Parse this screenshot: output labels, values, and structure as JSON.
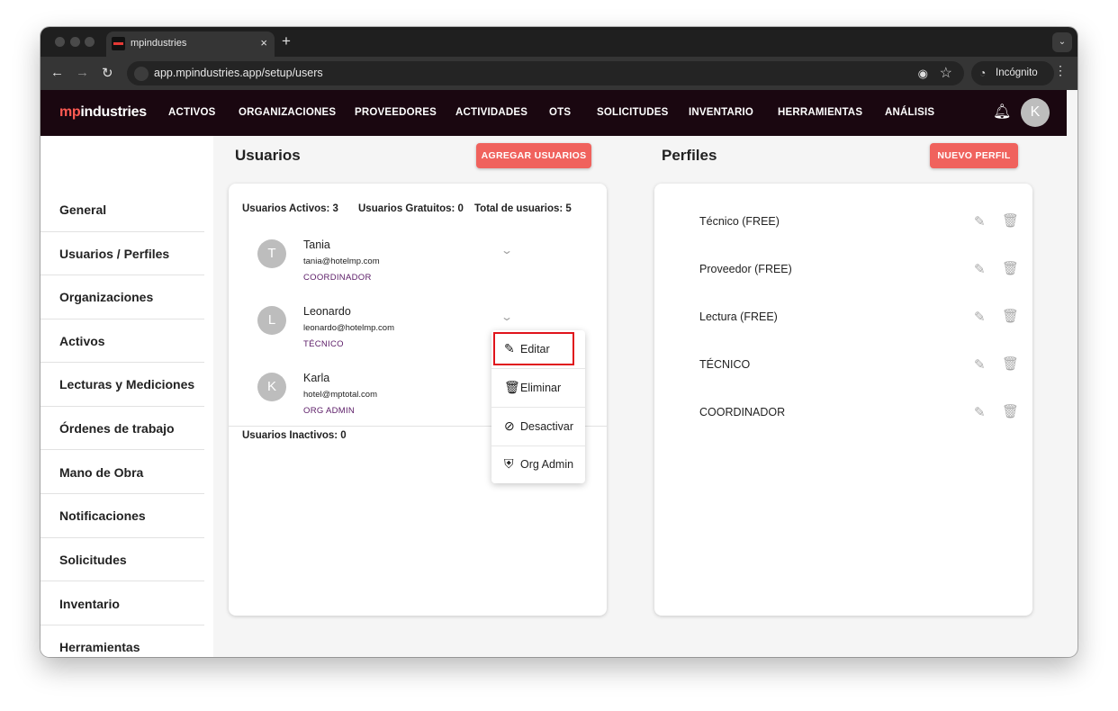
{
  "browser": {
    "tab_title": "mpindustries",
    "tab_close": "×",
    "new_tab": "+",
    "url": "app.mpindustries.app/setup/users",
    "incognito_label": "Incógnito"
  },
  "header": {
    "logo_mp": "mp",
    "logo_rest": "industries",
    "nav": [
      "ACTIVOS",
      "ORGANIZACIONES",
      "PROVEEDORES",
      "ACTIVIDADES",
      "OTS",
      "SOLICITUDES",
      "INVENTARIO",
      "HERRAMIENTAS",
      "ANÁLISIS"
    ],
    "user_initial": "K"
  },
  "sidebar": {
    "items": [
      "General",
      "Usuarios / Perfiles",
      "Organizaciones",
      "Activos",
      "Lecturas y Mediciones",
      "Órdenes de trabajo",
      "Mano de Obra",
      "Notificaciones",
      "Solicitudes",
      "Inventario",
      "Herramientas"
    ]
  },
  "users": {
    "title": "Usuarios",
    "add_button": "AGREGAR USUARIOS",
    "active_count": "Usuarios Activos: 3",
    "free_count": "Usuarios Gratuitos: 0",
    "total_count": "Total de usuarios: 5",
    "inactive_count": "Usuarios Inactivos: 0",
    "list": [
      {
        "initial": "T",
        "name": "Tania",
        "email": "tania@hotelmp.com",
        "role": "COORDINADOR"
      },
      {
        "initial": "L",
        "name": "Leonardo",
        "email": "leonardo@hotelmp.com",
        "role": "TÉCNICO"
      },
      {
        "initial": "K",
        "name": "Karla",
        "email": "hotel@mptotal.com",
        "role": "ORG ADMIN"
      }
    ]
  },
  "profiles": {
    "title": "Perfiles",
    "new_button": "NUEVO PERFIL",
    "list": [
      "Técnico (FREE)",
      "Proveedor (FREE)",
      "Lectura (FREE)",
      "TÉCNICO",
      "COORDINADOR"
    ]
  },
  "context_menu": {
    "items": [
      {
        "label": "Editar",
        "icon": "pencil-icon"
      },
      {
        "label": "Eliminar",
        "icon": "trash-icon"
      },
      {
        "label": "Desactivar",
        "icon": "block-icon"
      },
      {
        "label": "Org Admin",
        "icon": "shield-icon"
      }
    ]
  },
  "colors": {
    "accent": "#f0625d",
    "header_bg": "#1a0710",
    "role_text": "#5a1a66",
    "highlight": "#e0141b"
  }
}
